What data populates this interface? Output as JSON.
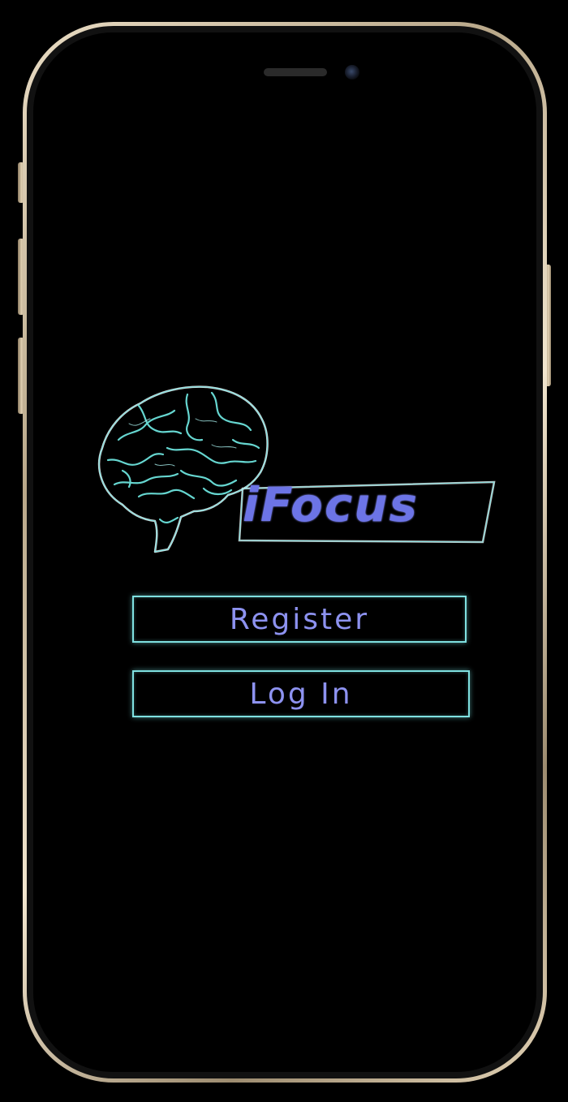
{
  "app": {
    "logo_text": "iFocus"
  },
  "actions": {
    "register_label": "Register",
    "login_label": "Log In"
  },
  "colors": {
    "background": "#000000",
    "accent_text": "#6c74e6",
    "button_border": "#7fe0e0",
    "brain_stroke": "#7fe0e0"
  },
  "icons": {
    "logo_icon": "brain-icon"
  }
}
